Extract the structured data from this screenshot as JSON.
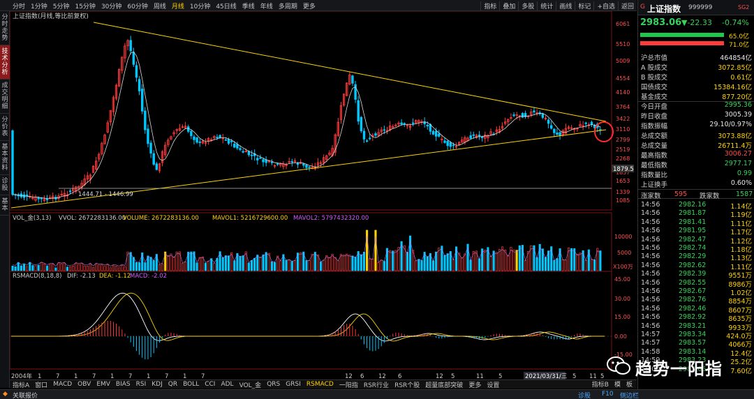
{
  "periods": [
    "分时",
    "1分钟",
    "5分钟",
    "15分钟",
    "30分钟",
    "60分钟",
    "周线",
    "月线",
    "10分钟",
    "45日线",
    "季线",
    "年线",
    "多周期",
    "更多"
  ],
  "active_period": "月线",
  "toolbar": [
    "指标",
    "叠加",
    "多股",
    "统计",
    "画线",
    "标记",
    "+自选",
    "返回"
  ],
  "left_tabs": [
    "分时走势",
    "技术分析",
    "成交明细",
    "分价表",
    "基本资料",
    "诊股",
    "基本"
  ],
  "main_title": "上证指数(月线,等比前复权)",
  "price_axis": [
    "6061",
    "5510",
    "5009",
    "4554",
    "4140",
    "3764",
    "3422",
    "3110",
    "2799",
    "2519",
    "2268",
    "1837",
    "1653",
    "1339",
    "1085"
  ],
  "price_marker": "1879.5",
  "low_label": "1444.71 - 1446.99",
  "vol_title": "VOL_金(3,13)",
  "vol_values": {
    "vvol": "VVOL: 2672283136.00",
    "volume": "VOLUME: 2672283136.00",
    "mavol1": "MAVOL1: 5216729600.00",
    "mavol2": "MAVOL2: 5797432320.00"
  },
  "vol_axis": [
    "10000",
    "5000",
    "X100万"
  ],
  "macd_title": "RSMACD(8,18,8)",
  "macd_values": {
    "dif": "DIF: -2.13",
    "dea": "DEA: -1.12",
    "macd": "MACD: -2.02"
  },
  "macd_axis": [
    "45.00",
    "30.00",
    "15.00",
    "0.00",
    "-15.00"
  ],
  "time_axis": {
    "start": "2004年",
    "cursor_date": "2021/03/31/三",
    "months": [
      "1",
      "7",
      "1",
      "7",
      "1",
      "7",
      "1",
      "7",
      "1",
      "7",
      "12",
      "6",
      "12",
      "6",
      "12",
      "5",
      "11",
      "5",
      "11",
      "5",
      "11",
      "5",
      "11",
      "5"
    ]
  },
  "indicator_tabs": [
    "指标A",
    "窗口",
    "MACD",
    "OBV",
    "EMV",
    "BIAS",
    "RSI",
    "KDJ",
    "QR",
    "BOLL",
    "CCI",
    "ADL",
    "VOL_金",
    "QRS",
    "GRSI",
    "RSMACD",
    "一阳指",
    "RSR行业",
    "RSR个股",
    "超量底部突破",
    "更多",
    "设置"
  ],
  "active_indicator": "RSMACD",
  "right_tabs": [
    "指标B",
    "模",
    "板"
  ],
  "status": {
    "left": "关联报价",
    "right_items": [
      "诊股",
      "F10",
      "侧边栏"
    ]
  },
  "quote": {
    "name": "上证指数",
    "code": "999999",
    "badge": "SG2",
    "price": "2983.06",
    "change": "▼-22.33",
    "pct": "-0.74%",
    "bar1_pct": "65.0亿",
    "bar2_pct": "71.0亿",
    "rows": [
      {
        "k": "沪总市值",
        "v": "464854亿",
        "c": "white"
      },
      {
        "k": "A 股成交",
        "v": "3072.85亿",
        "c": "yellow"
      },
      {
        "k": "B 股成交",
        "v": "0.61亿",
        "c": "yellow"
      },
      {
        "k": "国债成交",
        "v": "15384.16亿",
        "c": "yellow"
      },
      {
        "k": "基金成交",
        "v": "877.20亿",
        "c": "yellow"
      },
      {
        "k": "今日开盘",
        "v": "2995.36",
        "c": "green"
      },
      {
        "k": "昨日收盘",
        "v": "3005.39",
        "c": "white"
      },
      {
        "k": "指数振幅",
        "v": "29.10/0.97%",
        "c": "white"
      },
      {
        "k": "总成交额",
        "v": "3073.88亿",
        "c": "yellow"
      },
      {
        "k": "总成交量",
        "v": "26711.4万",
        "c": "yellow"
      },
      {
        "k": "最高指数",
        "v": "3006.27",
        "c": "red"
      },
      {
        "k": "最低指数",
        "v": "2977.17",
        "c": "green"
      },
      {
        "k": "指数量比",
        "v": "0.99",
        "c": "green"
      },
      {
        "k": "上证换手",
        "v": "0.60%",
        "c": "white"
      }
    ],
    "up_label": "涨家数",
    "up": "595",
    "down_label": "跌家数",
    "down": "1587",
    "ticks": [
      [
        "14:56",
        "2982.16",
        "1.14亿"
      ],
      [
        "14:56",
        "2981.87",
        "1.19亿"
      ],
      [
        "14:56",
        "2981.41",
        "1.11亿"
      ],
      [
        "14:56",
        "2981.95",
        "1.17亿"
      ],
      [
        "14:56",
        "2982.47",
        "1.12亿"
      ],
      [
        "14:56",
        "2982.74",
        "1.18亿"
      ],
      [
        "14:56",
        "2982.29",
        "1.13亿"
      ],
      [
        "14:56",
        "2982.62",
        "1.11亿"
      ],
      [
        "14:56",
        "2982.39",
        "9551万"
      ],
      [
        "14:56",
        "2982.55",
        "8986万"
      ],
      [
        "14:56",
        "2982.67",
        "1.02亿"
      ],
      [
        "14:56",
        "2982.76",
        "8854万"
      ],
      [
        "14:56",
        "2982.46",
        "8607万"
      ],
      [
        "14:56",
        "2982.92",
        "8635万"
      ],
      [
        "14:56",
        "2983.21",
        "9933万"
      ],
      [
        "14:57",
        "2983.34",
        "424.0万"
      ],
      [
        "14:57",
        "2983.57",
        "4066万"
      ],
      [
        "14:58",
        "2983.14",
        "12.4亿"
      ],
      [
        "14:59",
        "2983.23",
        "25.2亿"
      ],
      [
        "15:00",
        "2983.06",
        "7.60亿"
      ]
    ]
  },
  "watermark": "趋势一阳指",
  "colors": {
    "up": "#ff3b3b",
    "down": "#00c8ff",
    "yellow": "#ffd200",
    "ma": "#e0e0e0"
  }
}
